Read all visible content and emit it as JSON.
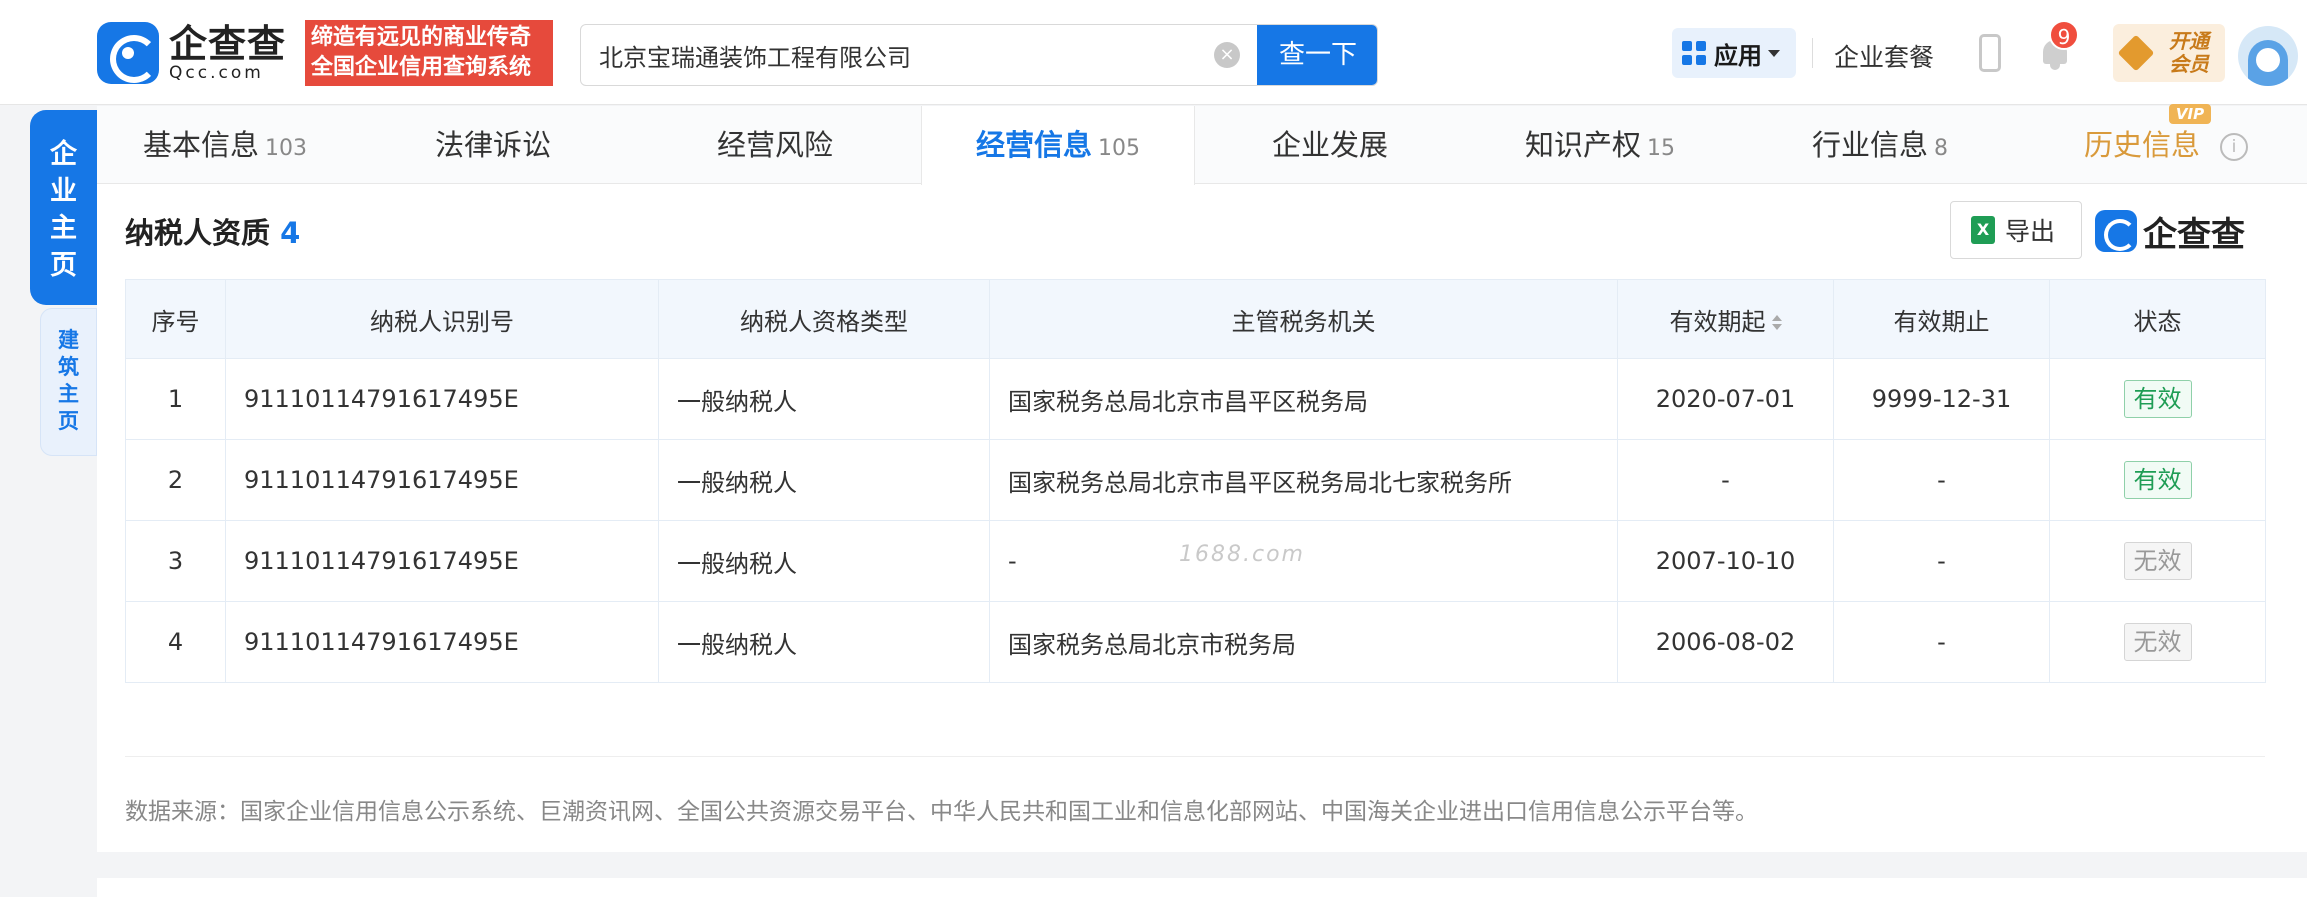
{
  "header": {
    "logo_cn": "企查查",
    "logo_en": "Qcc.com",
    "slogan_line1": "缔造有远见的商业传奇",
    "slogan_line2": "全国企业信用查询系统",
    "search_value": "北京宝瑞通装饰工程有限公司",
    "search_button": "查一下",
    "apps_label": "应用",
    "package_label": "企业套餐",
    "notification_count": "9",
    "vip_line1": "开通",
    "vip_line2": "会员"
  },
  "side_tabs": {
    "main": "企业主页",
    "sub": "建筑主页"
  },
  "tabs": [
    {
      "label": "基本信息",
      "count": "103"
    },
    {
      "label": "法律诉讼",
      "count": ""
    },
    {
      "label": "经营风险",
      "count": ""
    },
    {
      "label": "经营信息",
      "count": "105"
    },
    {
      "label": "企业发展",
      "count": ""
    },
    {
      "label": "知识产权",
      "count": "15"
    },
    {
      "label": "行业信息",
      "count": "8"
    },
    {
      "label": "历史信息",
      "count": ""
    }
  ],
  "vip_tag": "VIP",
  "section": {
    "title": "纳税人资质",
    "count": "4",
    "export_label": "导出",
    "brand": "企查查"
  },
  "table": {
    "headers": [
      "序号",
      "纳税人识别号",
      "纳税人资格类型",
      "主管税务机关",
      "有效期起",
      "有效期止",
      "状态"
    ],
    "rows": [
      {
        "no": "1",
        "tax_id": "91110114791617495E",
        "type": "一般纳税人",
        "authority": "国家税务总局北京市昌平区税务局",
        "start": "2020-07-01",
        "end": "9999-12-31",
        "status": "有效"
      },
      {
        "no": "2",
        "tax_id": "91110114791617495E",
        "type": "一般纳税人",
        "authority": "国家税务总局北京市昌平区税务局北七家税务所",
        "start": "-",
        "end": "-",
        "status": "有效"
      },
      {
        "no": "3",
        "tax_id": "91110114791617495E",
        "type": "一般纳税人",
        "authority": "-",
        "start": "2007-10-10",
        "end": "-",
        "status": "无效"
      },
      {
        "no": "4",
        "tax_id": "91110114791617495E",
        "type": "一般纳税人",
        "authority": "国家税务总局北京市税务局",
        "start": "2006-08-02",
        "end": "-",
        "status": "无效"
      }
    ]
  },
  "watermark": "1688.com",
  "source_text": "数据来源：国家企业信用信息公示系统、巨潮资讯网、全国公共资源交易平台、中华人民共和国工业和信息化部网站、中国海关企业进出口信用信息公示平台等。",
  "colors": {
    "accent": "#1677e6",
    "valid": "#1f9d55",
    "slogan": "#e64a3c"
  }
}
